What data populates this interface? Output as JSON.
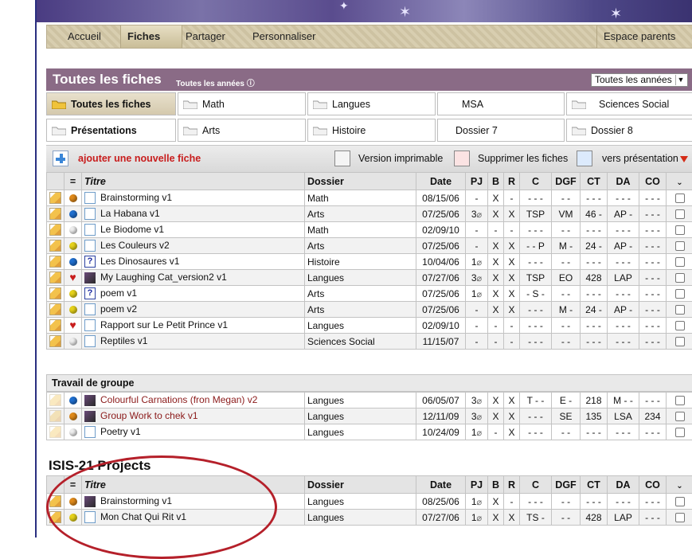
{
  "nav": {
    "items": [
      "Accueil",
      "Fiches",
      "Partager",
      "Personnaliser"
    ],
    "right": "Espace parents"
  },
  "header": {
    "title": "Toutes les fiches",
    "subtitle": "Toutes les années ⓘ",
    "year_select": "Toutes les années"
  },
  "folders": [
    [
      "Toutes les fiches",
      "Math",
      "Langues",
      "MSA",
      "Sciences Social"
    ],
    [
      "Présentations",
      "Arts",
      "Histoire",
      "Dossier 7",
      "Dossier 8"
    ]
  ],
  "actions": {
    "add": "ajouter une nouvelle fiche",
    "print": "Version imprimable",
    "delete": "Supprimer les fiches",
    "present": "vers présentation"
  },
  "columns": [
    "=",
    "Titre",
    "Dossier",
    "Date",
    "PJ",
    "B",
    "R",
    "C",
    "DGF",
    "CT",
    "DA",
    "CO"
  ],
  "rows": [
    {
      "status": "orange",
      "icon": "doc",
      "title": "Brainstorming v1",
      "dossier": "Math",
      "date": "08/15/06",
      "pj": "-",
      "b": "X",
      "r": "-",
      "c": "- - -",
      "dgf": "- -",
      "ct": "- - -",
      "da": "- - -",
      "co": "- - -"
    },
    {
      "status": "blue",
      "icon": "doc",
      "title": "La Habana v1",
      "dossier": "Arts",
      "date": "07/25/06",
      "pj": "3",
      "b": "X",
      "r": "X",
      "c": "TSP",
      "dgf": "VM",
      "ct": "46 -",
      "da": "AP -",
      "co": "- - -"
    },
    {
      "status": "white",
      "icon": "doc",
      "title": "Le Biodome v1",
      "dossier": "Math",
      "date": "02/09/10",
      "pj": "-",
      "b": "-",
      "r": "-",
      "c": "- - -",
      "dgf": "- -",
      "ct": "- - -",
      "da": "- - -",
      "co": "- - -"
    },
    {
      "status": "yellow",
      "icon": "doc",
      "title": "Les Couleurs v2",
      "dossier": "Arts",
      "date": "07/25/06",
      "pj": "-",
      "b": "X",
      "r": "X",
      "c": "- - P",
      "dgf": "M -",
      "ct": "24 -",
      "da": "AP -",
      "co": "- - -"
    },
    {
      "status": "blue",
      "icon": "q",
      "title": "Les Dinosaures v1",
      "dossier": "Histoire",
      "date": "10/04/06",
      "pj": "1",
      "b": "X",
      "r": "X",
      "c": "- - -",
      "dgf": "- -",
      "ct": "- - -",
      "da": "- - -",
      "co": "- - -"
    },
    {
      "status": "heart",
      "icon": "thumb",
      "title": "My Laughing Cat_version2 v1",
      "dossier": "Langues",
      "date": "07/27/06",
      "pj": "3",
      "b": "X",
      "r": "X",
      "c": "TSP",
      "dgf": "EO",
      "ct": "428",
      "da": "LAP",
      "co": "- - -"
    },
    {
      "status": "yellow",
      "icon": "q",
      "title": "poem v1",
      "dossier": "Arts",
      "date": "07/25/06",
      "pj": "1",
      "b": "X",
      "r": "X",
      "c": "- S -",
      "dgf": "- -",
      "ct": "- - -",
      "da": "- - -",
      "co": "- - -"
    },
    {
      "status": "yellow",
      "icon": "doc",
      "title": "poem v2",
      "dossier": "Arts",
      "date": "07/25/06",
      "pj": "-",
      "b": "X",
      "r": "X",
      "c": "- - -",
      "dgf": "M -",
      "ct": "24 -",
      "da": "AP -",
      "co": "- - -"
    },
    {
      "status": "heart",
      "icon": "doc",
      "title": "Rapport sur Le Petit Prince v1",
      "dossier": "Langues",
      "date": "02/09/10",
      "pj": "-",
      "b": "-",
      "r": "-",
      "c": "- - -",
      "dgf": "- -",
      "ct": "- - -",
      "da": "- - -",
      "co": "- - -"
    },
    {
      "status": "white",
      "icon": "doc",
      "title": "Reptiles v1",
      "dossier": "Sciences Social",
      "date": "11/15/07",
      "pj": "-",
      "b": "-",
      "r": "-",
      "c": "- - -",
      "dgf": "- -",
      "ct": "- - -",
      "da": "- - -",
      "co": "- - -"
    }
  ],
  "group": {
    "title": "Travail de groupe",
    "rows": [
      {
        "status": "blue",
        "icon": "thumb",
        "title": "Colourful Carnations (fron Megan) v2",
        "dossier": "Langues",
        "date": "06/05/07",
        "pj": "3",
        "b": "X",
        "r": "X",
        "c": "T - -",
        "dgf": "E -",
        "ct": "218",
        "da": "M - -",
        "co": "- - -"
      },
      {
        "status": "orange",
        "icon": "thumb",
        "title": "Group Work to chek v1",
        "dossier": "Langues",
        "date": "12/11/09",
        "pj": "3",
        "b": "X",
        "r": "X",
        "c": "- - -",
        "dgf": "SE",
        "ct": "135",
        "da": "LSA",
        "co": "234"
      },
      {
        "status": "white",
        "icon": "doc",
        "title": "Poetry v1",
        "dossier": "Langues",
        "date": "10/24/09",
        "pj": "1",
        "b": "-",
        "r": "X",
        "c": "- - -",
        "dgf": "- -",
        "ct": "- - -",
        "da": "- - -",
        "co": "- - -"
      }
    ]
  },
  "isis": {
    "title": "ISIS-21 Projects",
    "rows": [
      {
        "status": "orange",
        "icon": "thumb",
        "title": "Brainstorming v1",
        "dossier": "Langues",
        "date": "08/25/06",
        "pj": "1",
        "b": "X",
        "r": "-",
        "c": "- - -",
        "dgf": "- -",
        "ct": "- - -",
        "da": "- - -",
        "co": "- - -"
      },
      {
        "status": "yellow",
        "icon": "doc",
        "title": "Mon Chat Qui Rit v1",
        "dossier": "Langues",
        "date": "07/27/06",
        "pj": "1",
        "b": "X",
        "r": "X",
        "c": "TS -",
        "dgf": "- -",
        "ct": "428",
        "da": "LAP",
        "co": "- - -"
      }
    ]
  },
  "colors": {
    "orange": "#e08a1a",
    "blue": "#1f6fd0",
    "yellow": "#e6d21a",
    "white": "#eeeeee",
    "heart": "#c81d1d",
    "titlebar": "#8a6b86",
    "link_red": "#8b1a1a"
  }
}
